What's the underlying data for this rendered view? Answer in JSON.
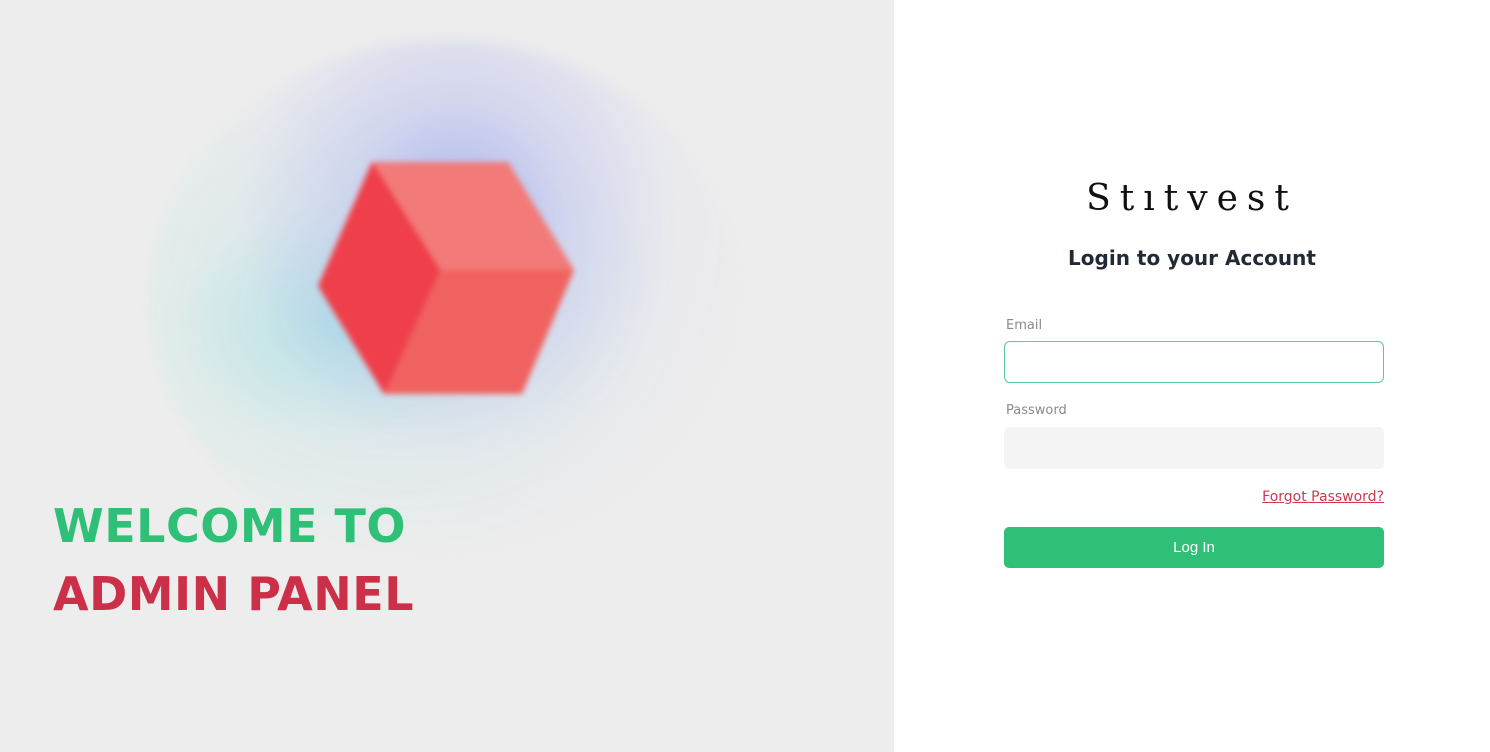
{
  "welcome": {
    "line1": "WELCOME TO",
    "line2": "ADMIN PANEL"
  },
  "brand": {
    "logo_text": "Stıtvest"
  },
  "login_form": {
    "title": "Login to your Account",
    "email_label": "Email",
    "email_value": "",
    "password_label": "Password",
    "password_value": "",
    "forgot_password_label": "Forgot Password?",
    "submit_label": "Log In"
  },
  "illustration": {
    "icon": "cube-icon"
  },
  "colors": {
    "accent_green": "#2fbf77",
    "accent_red": "#cc2f48",
    "left_bg": "#ededed",
    "cube_light": "#f27a78",
    "cube_dark": "#ee3f4a"
  }
}
